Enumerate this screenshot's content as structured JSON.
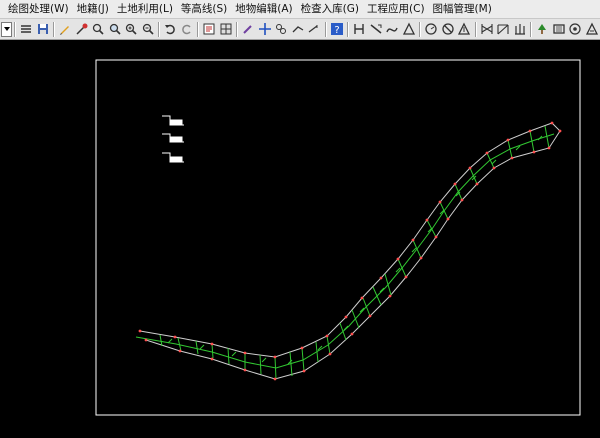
{
  "menubar": {
    "items": [
      {
        "label": "绘图处理(W)"
      },
      {
        "label": "地籍(J)"
      },
      {
        "label": "土地利用(L)"
      },
      {
        "label": "等高线(S)"
      },
      {
        "label": "地物编辑(A)"
      },
      {
        "label": "检查入库(G)"
      },
      {
        "label": "工程应用(C)"
      },
      {
        "label": "图幅管理(M)"
      }
    ]
  },
  "toolbar": {
    "icons": [
      "layer-combo-arrow",
      "list-icon",
      "save-icon",
      "pencil-icon",
      "magic-icon",
      "zoom-realtime-icon",
      "zoom-window-icon",
      "zoom-all-icon",
      "pan-icon",
      "undo-icon",
      "redo-icon",
      "properties-icon",
      "grid-icon",
      "edit-icon",
      "move-icon",
      "copy-icon",
      "trim-icon",
      "extend-icon",
      "help-icon",
      "road-icon",
      "slope-icon",
      "curve-icon",
      "triangle-icon",
      "circle-icon",
      "no-entry-icon",
      "arrow-up-icon",
      "fence-icon",
      "gate-icon",
      "grass-icon",
      "tree-icon",
      "square-icon",
      "target-icon",
      "warning-icon"
    ]
  },
  "colors": {
    "canvas_bg": "#000000",
    "frame": "#ffffff",
    "road_edge": "#c8c8c8",
    "road_symbol": "#32c832",
    "vertex": "#ff5050"
  }
}
